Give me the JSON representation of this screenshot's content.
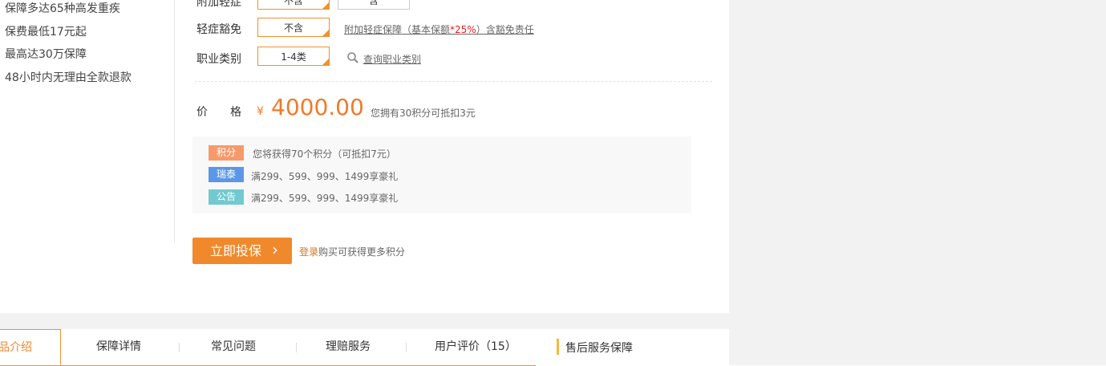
{
  "features": [
    "保障多达65种高发重疾",
    "保费最低17元起",
    "最高达30万保障",
    "48小时内无理由全款退款"
  ],
  "options": {
    "row1": {
      "label": "附加轻症",
      "selected": "不含",
      "other": "含"
    },
    "row2": {
      "label": "轻症豁免",
      "selected": "不含",
      "note_pre": "附加轻症保障（基本保额",
      "note_red": "*25%",
      "note_post": "）含豁免责任"
    },
    "row3": {
      "label": "职业类别",
      "selected": "1-4类",
      "link": "查询职业类别"
    }
  },
  "price": {
    "label": "价　　格",
    "currency": "¥",
    "amount": "4000.00",
    "points_note": "您拥有30积分可抵扣3元"
  },
  "promos": [
    {
      "tag": "积分",
      "color": "#f79a6a",
      "text": "您将获得70个积分（可抵扣7元）"
    },
    {
      "tag": "瑞泰",
      "color": "#5b97e6",
      "text": "满299、599、999、1499享豪礼"
    },
    {
      "tag": "公告",
      "color": "#72c9cf",
      "text": "满299、599、999、1499享豪礼"
    }
  ],
  "buy": {
    "button": "立即投保",
    "chevron": "›",
    "login": "登录",
    "login_suffix": "购买可获得更多积分"
  },
  "tabs": [
    "品介绍",
    "保障详情",
    "常见问题",
    "理赔服务",
    "用户评价（15）"
  ],
  "after_sales": "售后服务保障",
  "icons": {
    "search": "search-icon",
    "chevron": "chevron-right-icon"
  },
  "colors": {
    "accent": "#f0892b",
    "price": "#f07a2b"
  }
}
